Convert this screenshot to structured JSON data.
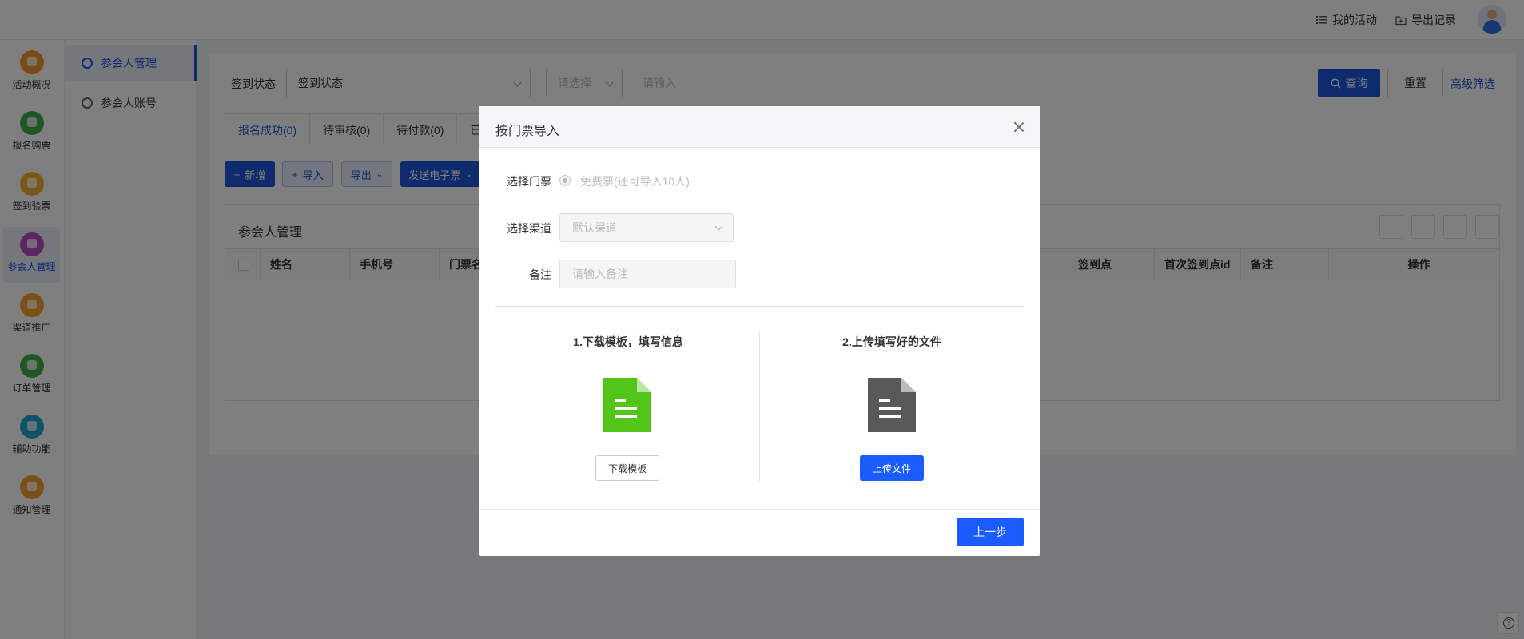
{
  "topbar": {
    "my_activities": "我的活动",
    "export_records": "导出记录"
  },
  "leftnav": [
    {
      "label": "活动概况",
      "icon": "dashboard-icon",
      "color": "#f39a2b"
    },
    {
      "label": "报名购票",
      "icon": "ticket-icon",
      "color": "#3db34a"
    },
    {
      "label": "签到验票",
      "icon": "checkin-icon",
      "color": "#f3b12b"
    },
    {
      "label": "参会人管理",
      "icon": "attendee-icon",
      "color": "#b44fc7"
    },
    {
      "label": "渠道推广",
      "icon": "channel-icon",
      "color": "#f3a12b"
    },
    {
      "label": "订单管理",
      "icon": "order-icon",
      "color": "#3db34a"
    },
    {
      "label": "辅助功能",
      "icon": "assist-icon",
      "color": "#1ea7c9"
    },
    {
      "label": "通知管理",
      "icon": "notice-icon",
      "color": "#f3a12b"
    }
  ],
  "subnav": [
    {
      "label": "参会人管理"
    },
    {
      "label": "参会人账号"
    }
  ],
  "filters": {
    "checkin_label": "签到状态",
    "checkin_value": "签到状态",
    "select_placeholder": "请选择",
    "input_placeholder": "请输入",
    "query": "查询",
    "reset": "重置",
    "advanced": "高级筛选"
  },
  "tabs": [
    {
      "label": "报名成功(0)"
    },
    {
      "label": "待审核(0)"
    },
    {
      "label": "待付款(0)"
    },
    {
      "label": "已"
    }
  ],
  "actions": {
    "add": "新增",
    "import": "导入",
    "export": "导出",
    "send_ticket": "发送电子票"
  },
  "table": {
    "title": "参会人管理",
    "columns_left": [
      "姓名",
      "手机号",
      "门票名"
    ],
    "columns_right": [
      "签到点",
      "首次签到点id",
      "备注",
      "操作"
    ]
  },
  "modal": {
    "title": "按门票导入",
    "ticket_label": "选择门票",
    "ticket_option": "免费票(还可导入10人)",
    "channel_label": "选择渠道",
    "channel_value": "默认渠道",
    "remark_label": "备注",
    "remark_placeholder": "请输入备注",
    "step1": "1.下载模板，填写信息",
    "step2": "2.上传填写好的文件",
    "download_btn": "下载模板",
    "upload_btn": "上传文件",
    "back_btn": "上一步"
  },
  "colors": {
    "primary": "#1a56db",
    "template_icon": "#52c41a",
    "upload_icon": "#595959"
  }
}
